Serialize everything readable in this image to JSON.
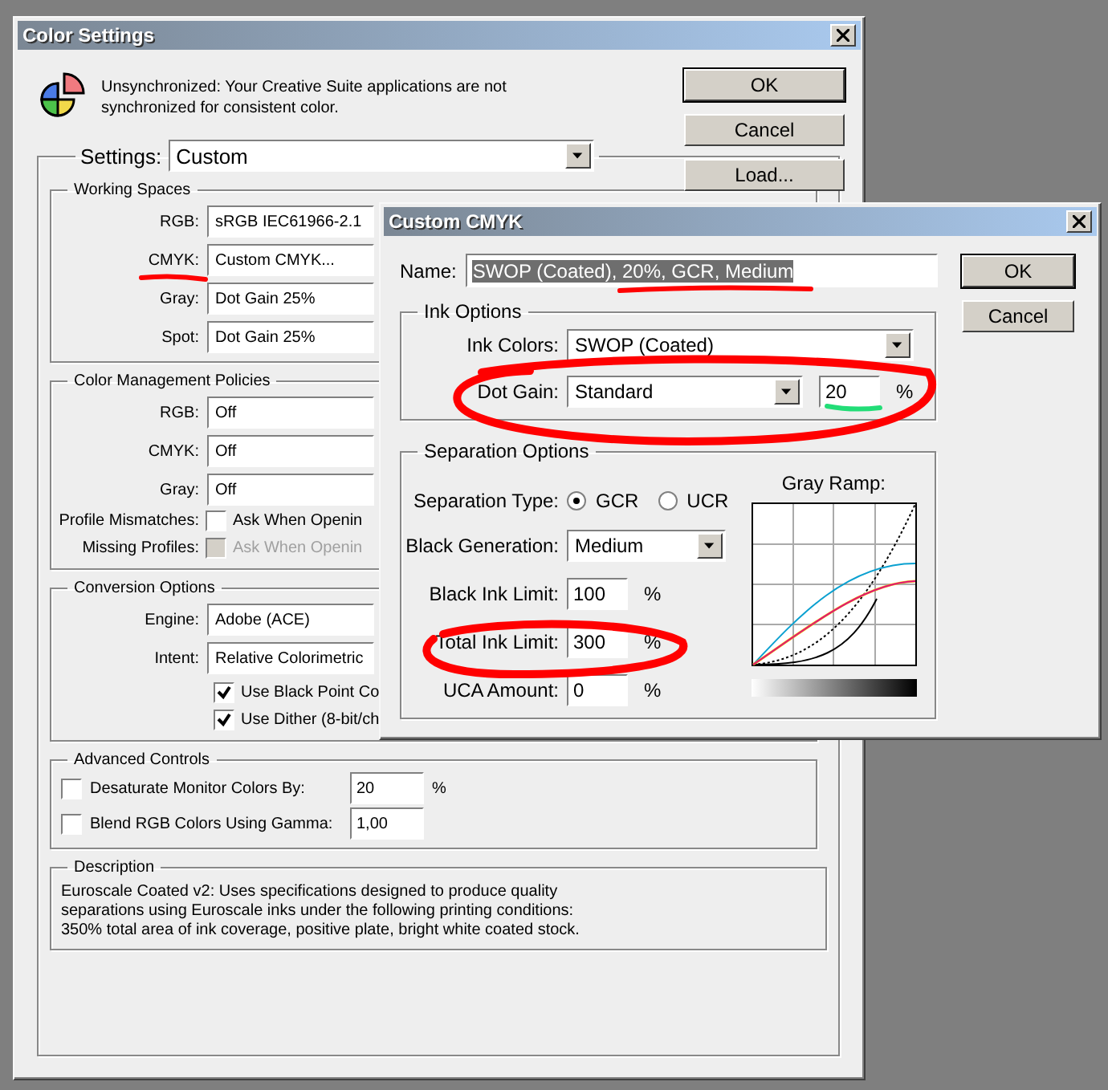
{
  "color_settings": {
    "title": "Color Settings",
    "message": "Unsynchronized: Your Creative Suite applications are not synchronized for consistent color.",
    "buttons": [
      "OK",
      "Cancel",
      "Load..."
    ],
    "settings": {
      "label": "Settings:",
      "value": "Custom"
    },
    "working_spaces": {
      "title": "Working Spaces",
      "fields": [
        {
          "label": "RGB:",
          "value": "sRGB IEC61966-2.1"
        },
        {
          "label": "CMYK:",
          "value": "Custom CMYK..."
        },
        {
          "label": "Gray:",
          "value": "Dot Gain 25%"
        },
        {
          "label": "Spot:",
          "value": "Dot Gain 25%"
        }
      ]
    },
    "policies": {
      "title": "Color Management Policies",
      "fields": [
        {
          "label": "RGB:",
          "value": "Off"
        },
        {
          "label": "CMYK:",
          "value": "Off"
        },
        {
          "label": "Gray:",
          "value": "Off"
        }
      ],
      "checks": [
        {
          "label": "Profile Mismatches:",
          "text": "Ask When Openin",
          "checked": false,
          "disabled": false
        },
        {
          "label": "Missing Profiles:",
          "text": "Ask When Openin",
          "checked": false,
          "disabled": true
        }
      ]
    },
    "conversion": {
      "title": "Conversion Options",
      "fields": [
        {
          "label": "Engine:",
          "value": "Adobe (ACE)"
        },
        {
          "label": "Intent:",
          "value": "Relative Colorimetric"
        }
      ],
      "checks": [
        {
          "text": "Use Black Point Co",
          "checked": true
        },
        {
          "text": "Use Dither (8-bit/ch",
          "checked": true
        }
      ]
    },
    "advanced": {
      "title": "Advanced Controls",
      "rows": [
        {
          "text": "Desaturate Monitor Colors By:",
          "checked": false,
          "value": "20",
          "unit": "%"
        },
        {
          "text": "Blend RGB Colors Using Gamma:",
          "checked": false,
          "value": "1,00"
        }
      ]
    },
    "description": {
      "title": "Description",
      "lines": [
        "Euroscale Coated v2:  Uses specifications designed to produce quality",
        "separations using Euroscale inks under the following printing conditions:",
        "350% total area of ink coverage, positive plate, bright white coated stock."
      ]
    }
  },
  "custom_cmyk": {
    "title": "Custom CMYK",
    "name": {
      "label": "Name:",
      "value": "SWOP (Coated), 20%, GCR, Medium",
      "text_selected": true
    },
    "buttons": [
      "OK",
      "Cancel"
    ],
    "ink_options": {
      "title": "Ink Options",
      "ink_colors": {
        "label": "Ink Colors:",
        "value": "SWOP (Coated)"
      },
      "dot_gain": {
        "label": "Dot Gain:",
        "value": "Standard",
        "amount": "20",
        "unit": "%"
      }
    },
    "separation": {
      "title": "Separation Options",
      "type_label": "Separation Type:",
      "types": [
        {
          "label": "GCR",
          "selected": true
        },
        {
          "label": "UCR",
          "selected": false
        }
      ],
      "black_generation": {
        "label": "Black Generation:",
        "value": "Medium"
      },
      "limits": [
        {
          "label": "Black Ink Limit:",
          "value": "100",
          "unit": "%"
        },
        {
          "label": "Total Ink Limit:",
          "value": "300",
          "unit": "%"
        },
        {
          "label": "UCA Amount:",
          "value": "0",
          "unit": "%"
        }
      ],
      "gray_ramp": {
        "label": "Gray Ramp:"
      }
    }
  },
  "annotations": [
    {
      "kind": "underline",
      "color": "#ff0000"
    },
    {
      "kind": "underline",
      "color": "#ff0000"
    },
    {
      "kind": "loop",
      "color": "#ff0000"
    },
    {
      "kind": "underline",
      "color": "#22dd77"
    },
    {
      "kind": "loop",
      "color": "#ff0000"
    }
  ]
}
